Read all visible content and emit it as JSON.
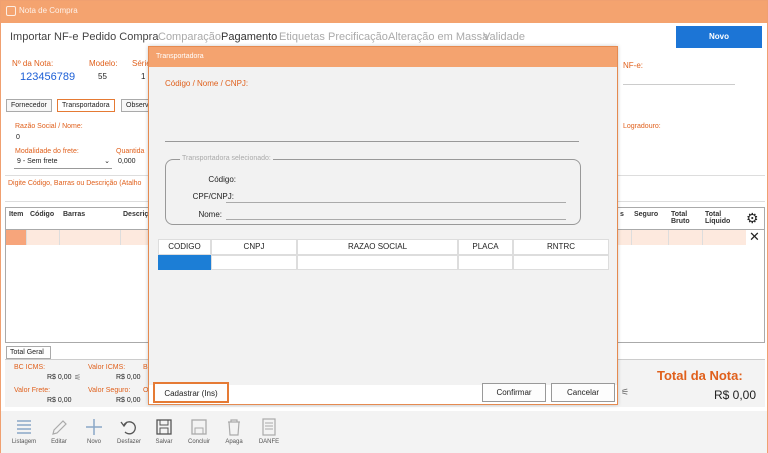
{
  "window": {
    "title": "Nota de Compra"
  },
  "menu": [
    {
      "label": "Importar NF-e",
      "state": "normal"
    },
    {
      "label": "Pedido Compra",
      "state": "normal"
    },
    {
      "label": "Comparação",
      "state": "dim"
    },
    {
      "label": "Pagamento",
      "state": "bold"
    },
    {
      "label": "Etiquetas",
      "state": "dim"
    },
    {
      "label": "Precificação",
      "state": "dim"
    },
    {
      "label": "Alteração em Massa",
      "state": "dim"
    },
    {
      "label": "Validade",
      "state": "dim"
    }
  ],
  "novo_label": "Novo",
  "header": {
    "nota_label": "Nº da Nota:",
    "nota_value": "123456789",
    "modelo_label": "Modelo:",
    "modelo_value": "55",
    "serie_label": "Série",
    "serie_value": "1",
    "nfe_label": "NF-e:"
  },
  "tabs": [
    "Fornecedor",
    "Transportadora",
    "Observ"
  ],
  "transp": {
    "razao_label": "Razão Social / Nome:",
    "razao_value": "0",
    "logradouro_label": "Logradouro:",
    "modalidade_label": "Modalidade do frete:",
    "modalidade_value": "9 - Sem frete",
    "quantidade_label": "Quantida",
    "quantidade_value": "0,000"
  },
  "product_search": "Digite Código, Barras ou Descrição (Atalho",
  "grid": {
    "headers": [
      "Item",
      "Código",
      "Barras",
      "Descriç",
      "s",
      "Seguro",
      "Total Bruto",
      "Total Líquido"
    ]
  },
  "totals": {
    "tab_label": "Total Geral",
    "bc_icms_label": "BC ICMS:",
    "bc_icms_value": "R$ 0,00",
    "valor_icms_label": "Valor ICMS:",
    "valor_icms_value": "R$ 0,00",
    "b_label": "B",
    "valor_frete_label": "Valor Frete:",
    "valor_frete_value": "R$ 0,00",
    "valor_seguro_label": "Valor Seguro:",
    "valor_seguro_value": "R$ 0,00",
    "o_label": "O",
    "total_nota_label": "Total da Nota:",
    "total_nota_value": "R$ 0,00"
  },
  "toolbar": [
    {
      "label": "Listagem",
      "icon": "list-icon"
    },
    {
      "label": "Editar",
      "icon": "pencil-icon"
    },
    {
      "label": "Novo",
      "icon": "plus-icon"
    },
    {
      "label": "Desfazer",
      "icon": "undo-icon"
    },
    {
      "label": "Salvar",
      "icon": "save-icon"
    },
    {
      "label": "Concluir",
      "icon": "floppy-icon"
    },
    {
      "label": "Apaga",
      "icon": "trash-icon"
    },
    {
      "label": "DANFE",
      "icon": "document-icon"
    }
  ],
  "dialog": {
    "title": "Transportadora",
    "search_label": "Código / Nome / CNPJ:",
    "selected_group": "Transportadora selecionado:",
    "codigo_label": "Código:",
    "cpf_label": "CPF/CNPJ:",
    "nome_label": "Nome:",
    "columns": [
      "CODIGO",
      "CNPJ",
      "RAZAO SOCIAL",
      "PLACA",
      "RNTRC"
    ],
    "cadastrar_label": "Cadastrar (Ins)",
    "confirmar_label": "Confirmar",
    "cancelar_label": "Cancelar"
  },
  "colors": {
    "accent": "#f4a36f",
    "orange_text": "#e0601c",
    "blue": "#1c75d6"
  }
}
